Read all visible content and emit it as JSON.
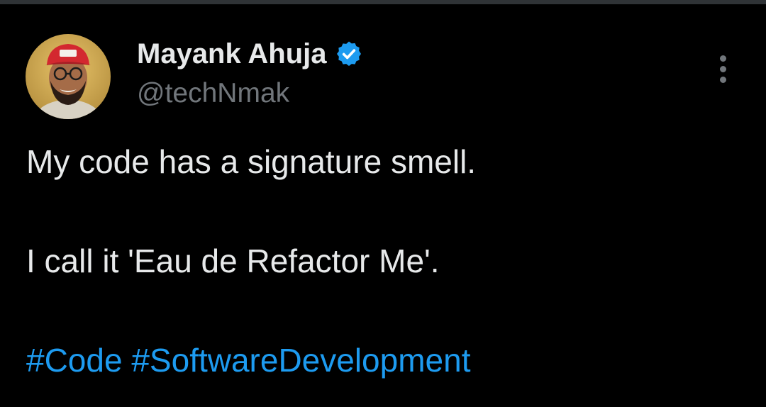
{
  "tweet": {
    "author": {
      "display_name": "Mayank Ahuja",
      "handle": "@techNmak",
      "verified": true,
      "avatar_icon": "profile-photo"
    },
    "body": {
      "line1": "My code has a signature smell.",
      "line2": "I call it 'Eau de Refactor Me'.",
      "hashtags": [
        "#Code",
        "#SoftwareDevelopment"
      ]
    },
    "more_icon": "more-vertical-icon"
  },
  "colors": {
    "background": "#000000",
    "text": "#e7e9ea",
    "secondary_text": "#71767b",
    "accent": "#1d9bf0"
  }
}
